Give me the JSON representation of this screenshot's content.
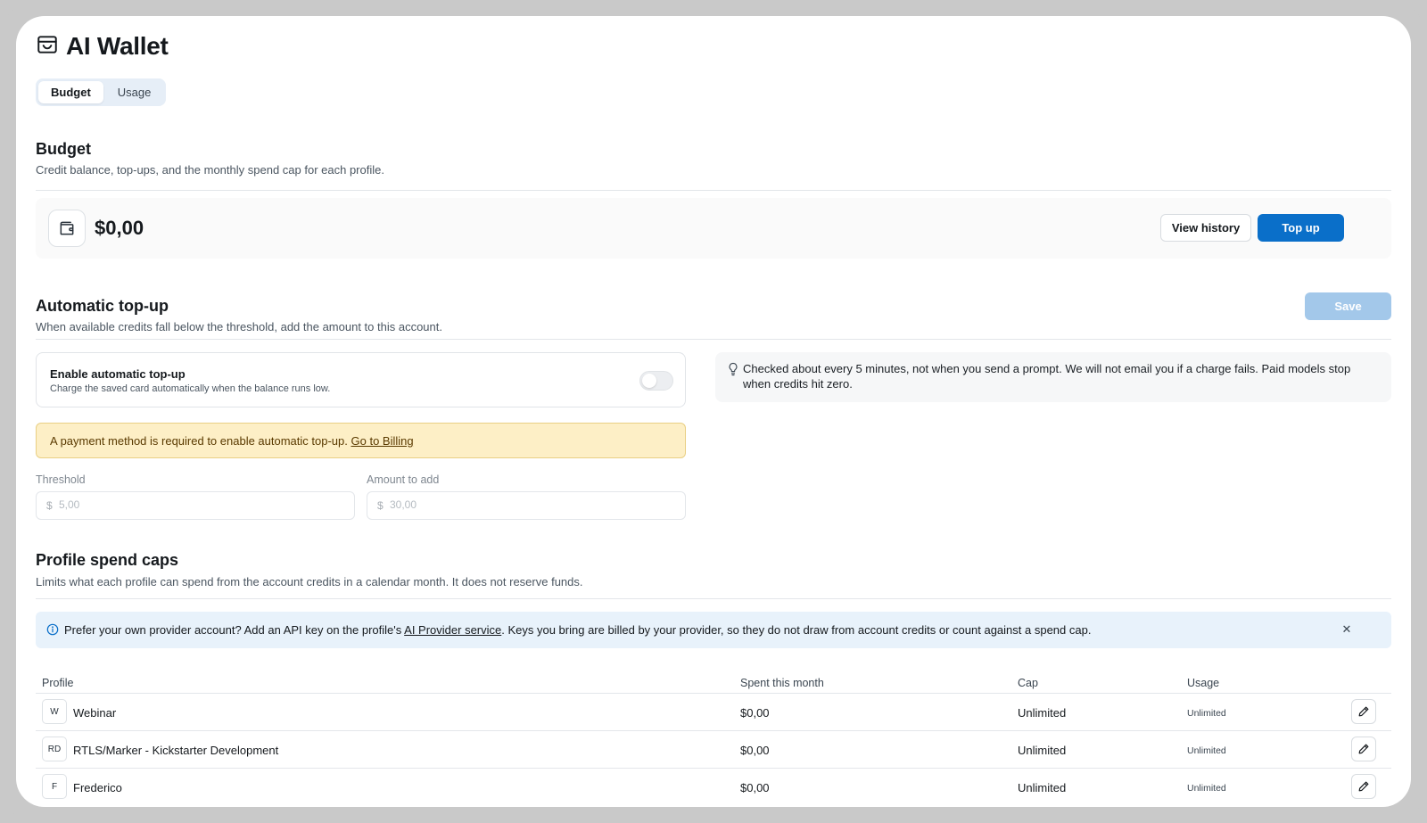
{
  "app": {
    "title": "AI Wallet"
  },
  "tabs": [
    {
      "label": "Budget",
      "active": true
    },
    {
      "label": "Usage",
      "active": false
    }
  ],
  "budget": {
    "title": "Budget",
    "subtitle": "Credit balance, top-ups, and the monthly spend cap for each profile.",
    "balance": "$0,00",
    "view_history_label": "View history",
    "top_up_label": "Top up"
  },
  "auto_topup": {
    "title": "Automatic top-up",
    "subtitle": "When available credits fall below the threshold, add the amount to this account.",
    "save_label": "Save",
    "toggle_title": "Enable automatic top-up",
    "toggle_sub": "Charge the saved card automatically when the balance runs low.",
    "toggle_on": false,
    "info_text": "Checked about every 5 minutes, not when you send a prompt. We will not email you if a charge fails. Paid models stop when credits hit zero.",
    "warning_text": "A payment method is required to enable automatic top-up.",
    "warning_link": "Go to Billing",
    "threshold_label": "Threshold",
    "threshold_currency": "$",
    "threshold_placeholder": "5,00",
    "amount_label": "Amount to add",
    "amount_currency": "$",
    "amount_placeholder": "30,00"
  },
  "spend_caps": {
    "title": "Profile spend caps",
    "subtitle": "Limits what each profile can spend from the account credits in a calendar month. It does not reserve funds.",
    "notice_prefix": "Prefer your own provider account? Add an API key on the profile's ",
    "notice_link": "AI Provider service",
    "notice_suffix": ". Keys you bring are billed by your provider, so they do not draw from account credits or count against a spend cap.",
    "notice_close": "✕",
    "columns": {
      "profile": "Profile",
      "spent": "Spent this month",
      "cap": "Cap",
      "usage": "Usage"
    },
    "rows": [
      {
        "initials": "W",
        "name": "Webinar",
        "spent": "$0,00",
        "cap": "Unlimited",
        "usage": "Unlimited"
      },
      {
        "initials": "RD",
        "name": "RTLS/Marker - Kickstarter Development",
        "spent": "$0,00",
        "cap": "Unlimited",
        "usage": "Unlimited"
      },
      {
        "initials": "F",
        "name": "Frederico",
        "spent": "$0,00",
        "cap": "Unlimited",
        "usage": "Unlimited"
      }
    ]
  },
  "colors": {
    "primary": "#0a6fc9",
    "primary_disabled": "#a3c8ea",
    "warning_bg": "#fdefc6",
    "notice_bg": "#e8f2fb"
  },
  "icons": {
    "title": "wallet-icon",
    "balance": "wallet-icon",
    "info": "lightbulb-icon",
    "notice": "info-circle-icon",
    "edit": "pencil-icon"
  }
}
